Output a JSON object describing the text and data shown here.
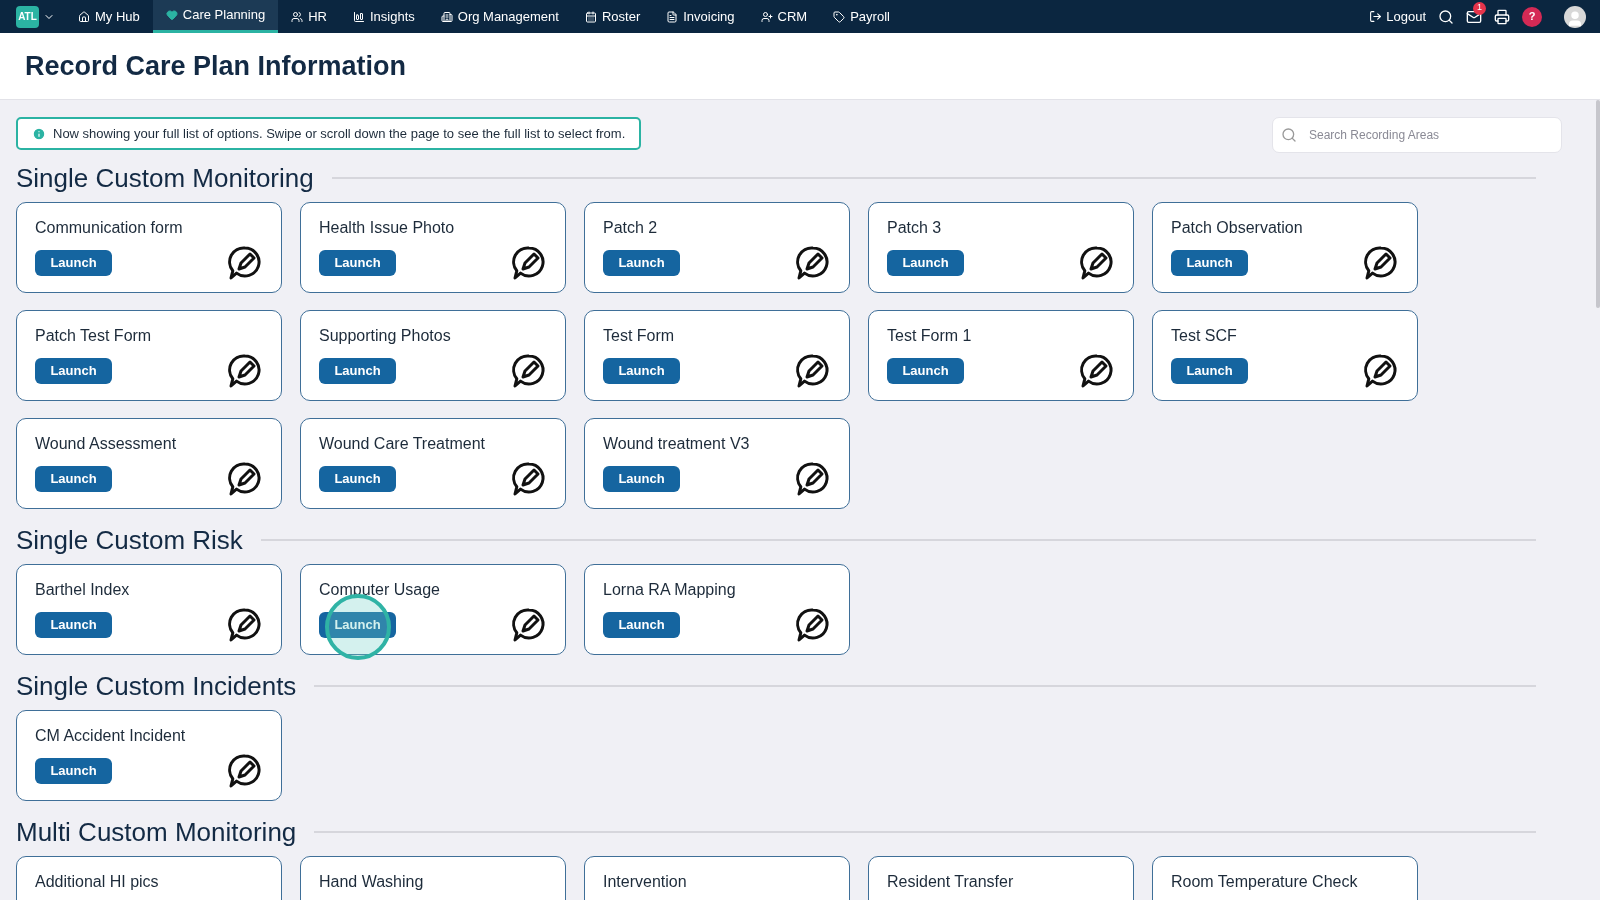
{
  "nav": {
    "logo": "ATL",
    "items": [
      {
        "label": "My Hub",
        "selected": false
      },
      {
        "label": "Care Planning",
        "selected": true
      },
      {
        "label": "HR",
        "selected": false
      },
      {
        "label": "Insights",
        "selected": false
      },
      {
        "label": "Org Management",
        "selected": false
      },
      {
        "label": "Roster",
        "selected": false
      },
      {
        "label": "Invoicing",
        "selected": false
      },
      {
        "label": "CRM",
        "selected": false
      },
      {
        "label": "Payroll",
        "selected": false
      }
    ],
    "logout": "Logout",
    "mail_badge": "1",
    "help": "?"
  },
  "page_title": "Record Care Plan Information",
  "info_banner": "Now showing your full list of options. Swipe or scroll down the page to see the full list to select from.",
  "search": {
    "placeholder": "Search Recording Areas"
  },
  "sections": [
    {
      "title": "Single Custom Monitoring",
      "cards": [
        {
          "name": "Communication form",
          "button": "Launch",
          "highlighted": false
        },
        {
          "name": "Health Issue Photo",
          "button": "Launch",
          "highlighted": false
        },
        {
          "name": "Patch 2",
          "button": "Launch",
          "highlighted": false
        },
        {
          "name": "Patch 3",
          "button": "Launch",
          "highlighted": false
        },
        {
          "name": "Patch Observation",
          "button": "Launch",
          "highlighted": false
        },
        {
          "name": "Patch Test Form",
          "button": "Launch",
          "highlighted": false
        },
        {
          "name": "Supporting Photos",
          "button": "Launch",
          "highlighted": false
        },
        {
          "name": "Test Form",
          "button": "Launch",
          "highlighted": false
        },
        {
          "name": "Test Form 1",
          "button": "Launch",
          "highlighted": false
        },
        {
          "name": "Test SCF",
          "button": "Launch",
          "highlighted": false
        },
        {
          "name": "Wound Assessment",
          "button": "Launch",
          "highlighted": false
        },
        {
          "name": "Wound Care Treatment",
          "button": "Launch",
          "highlighted": false
        },
        {
          "name": "Wound treatment V3",
          "button": "Launch",
          "highlighted": false
        }
      ]
    },
    {
      "title": "Single Custom Risk",
      "cards": [
        {
          "name": "Barthel Index",
          "button": "Launch",
          "highlighted": false
        },
        {
          "name": "Computer Usage",
          "button": "Launch",
          "highlighted": true
        },
        {
          "name": "Lorna RA Mapping",
          "button": "Launch",
          "highlighted": false
        }
      ]
    },
    {
      "title": "Single Custom Incidents",
      "cards": [
        {
          "name": "CM Accident Incident",
          "button": "Launch",
          "highlighted": false
        }
      ]
    },
    {
      "title": "Multi Custom Monitoring",
      "cards": [
        {
          "name": "Additional HI pics"
        },
        {
          "name": "Hand Washing"
        },
        {
          "name": "Intervention"
        },
        {
          "name": "Resident Transfer"
        },
        {
          "name": "Room Temperature Check"
        }
      ]
    }
  ]
}
